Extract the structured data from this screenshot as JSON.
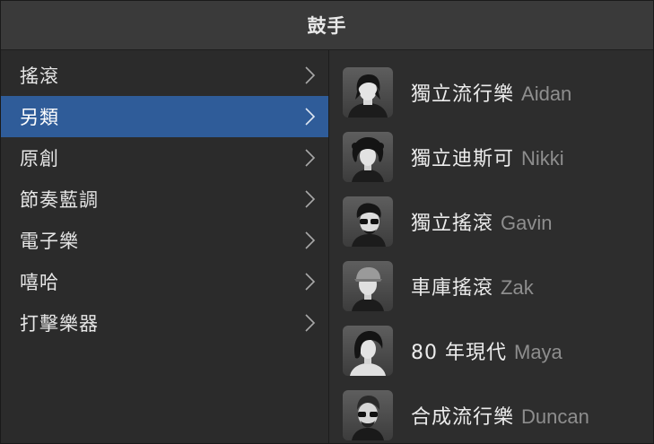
{
  "window": {
    "title": "鼓手"
  },
  "categories": [
    {
      "label": "搖滾",
      "selected": false
    },
    {
      "label": "另類",
      "selected": true
    },
    {
      "label": "原創",
      "selected": false
    },
    {
      "label": "節奏藍調",
      "selected": false
    },
    {
      "label": "電子樂",
      "selected": false
    },
    {
      "label": "嘻哈",
      "selected": false
    },
    {
      "label": "打擊樂器",
      "selected": false
    }
  ],
  "drummers": [
    {
      "style": "獨立流行樂",
      "name": "Aidan",
      "icon": "aidan-avatar-icon"
    },
    {
      "style": "獨立迪斯可",
      "name": "Nikki",
      "icon": "nikki-avatar-icon"
    },
    {
      "style": "獨立搖滾",
      "name": "Gavin",
      "icon": "gavin-avatar-icon"
    },
    {
      "style": "車庫搖滾",
      "name": "Zak",
      "icon": "zak-avatar-icon"
    },
    {
      "style": "80 年現代",
      "name": "Maya",
      "icon": "maya-avatar-icon"
    },
    {
      "style": "合成流行樂",
      "name": "Duncan",
      "icon": "duncan-avatar-icon"
    }
  ],
  "colors": {
    "selection": "#2f5c99",
    "background": "#2b2b2b",
    "titlebar": "#3a3a3a"
  }
}
